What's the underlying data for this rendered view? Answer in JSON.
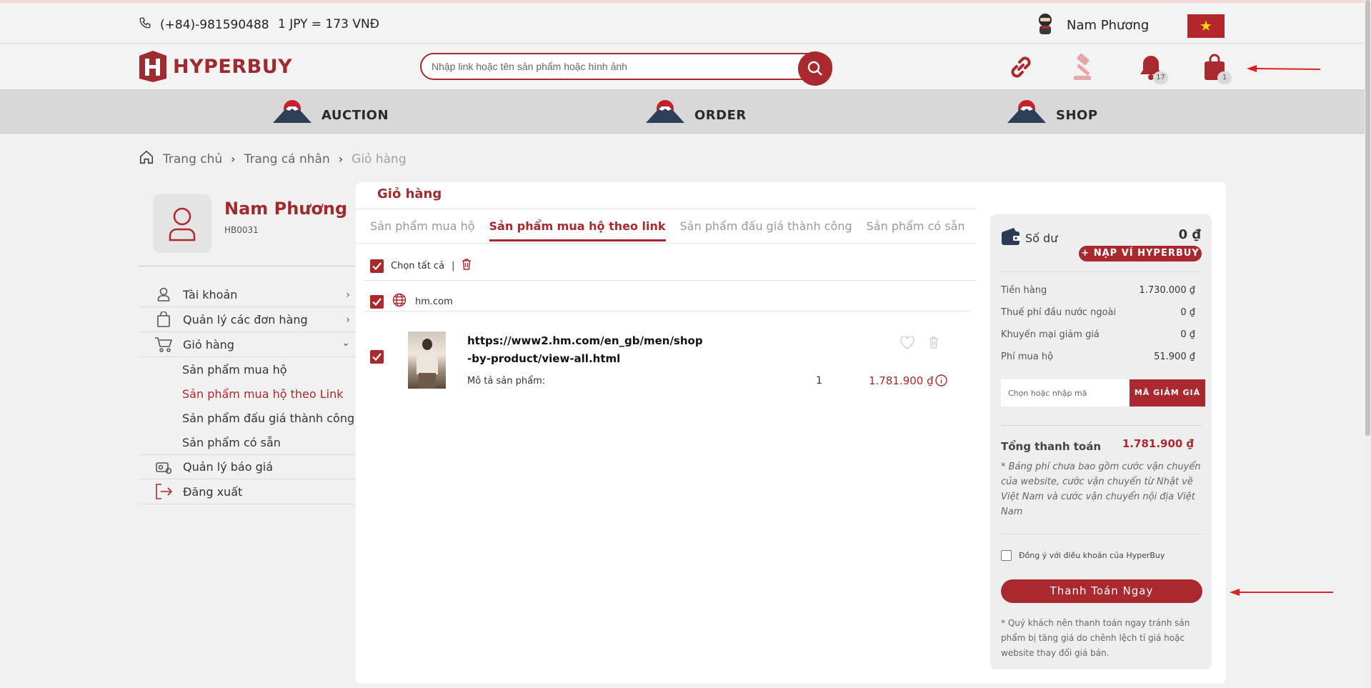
{
  "topbar": {
    "phone": "(+84)-981590488",
    "rate": "1 JPY = 173 VNĐ",
    "user_name": "Nam Phương"
  },
  "header": {
    "brand": "HYPERBUY",
    "search_placeholder": "Nhập link hoặc tên sản phẩm hoặc hình ảnh",
    "notification_count": "17",
    "cart_count": "1"
  },
  "nav": {
    "items": [
      "AUCTION",
      "ORDER",
      "SHOP"
    ]
  },
  "breadcrumb": {
    "home": "Trang chủ",
    "profile": "Trang cá nhân",
    "current": "Giỏ hàng"
  },
  "sidebar": {
    "name": "Nam Phương",
    "id": "HB0031",
    "menu": {
      "account": "Tài khoản",
      "orders": "Quản lý các đơn hàng",
      "cart": "Giỏ hàng",
      "cart_sub": [
        "Sản phẩm mua hộ",
        "Sản phẩm mua hộ theo Link",
        "Sản phẩm đấu giá thành công",
        "Sản phẩm có sẵn"
      ],
      "quotes": "Quản lý báo giá",
      "logout": "Đăng xuất"
    }
  },
  "main": {
    "title": "Giỏ hàng",
    "tabs": [
      "Sản phẩm mua hộ",
      "Sản phẩm mua hộ theo link",
      "Sản phẩm đấu giá thành công",
      "Sản phẩm có sẵn"
    ],
    "select_all": "Chọn tất cả",
    "divider": "|",
    "store": "hm.com",
    "item": {
      "url": "https://www2.hm.com/en_gb/men/shop-by-product/view-all.html",
      "desc_label": "Mô tả sản phẩm:",
      "quantity": "1",
      "price": "1.781.900 ₫"
    }
  },
  "summary": {
    "balance_label": "Số dư",
    "balance_value": "0 ₫",
    "topup_button": "+ NẠP VÍ HYPERBUY",
    "rows": [
      {
        "label": "Tiền hàng",
        "value": "1.730.000 ₫"
      },
      {
        "label": "Thuế phí đầu nước ngoài",
        "value": "0 ₫"
      },
      {
        "label": "Khuyến mại giảm giá",
        "value": "0 ₫"
      },
      {
        "label": "Phí mua hộ",
        "value": "51.900 ₫"
      }
    ],
    "coupon_placeholder": "Chọn hoặc nhập mã",
    "coupon_button": "MÃ GIẢM GIÁ",
    "total_label": "Tổng thanh toán",
    "total_value": "1.781.900 ₫",
    "note": "* Bảng phí chưa bao gồm cước vận chuyển của website, cước vận chuyển từ Nhật về Việt Nam và cước vận chuyển nội địa Việt Nam",
    "agree_label": "Đồng ý với điều khoản của HyperBuy",
    "pay_button": "Thanh Toán Ngay",
    "pay_note": "* Quý khách nên thanh toán ngay tránh sản phẩm bị tăng giá do chênh lệch tỉ giá hoặc website thay đổi giá bán."
  },
  "colors": {
    "brand": "#a9292e",
    "annotation_arrow": "#e02020"
  }
}
